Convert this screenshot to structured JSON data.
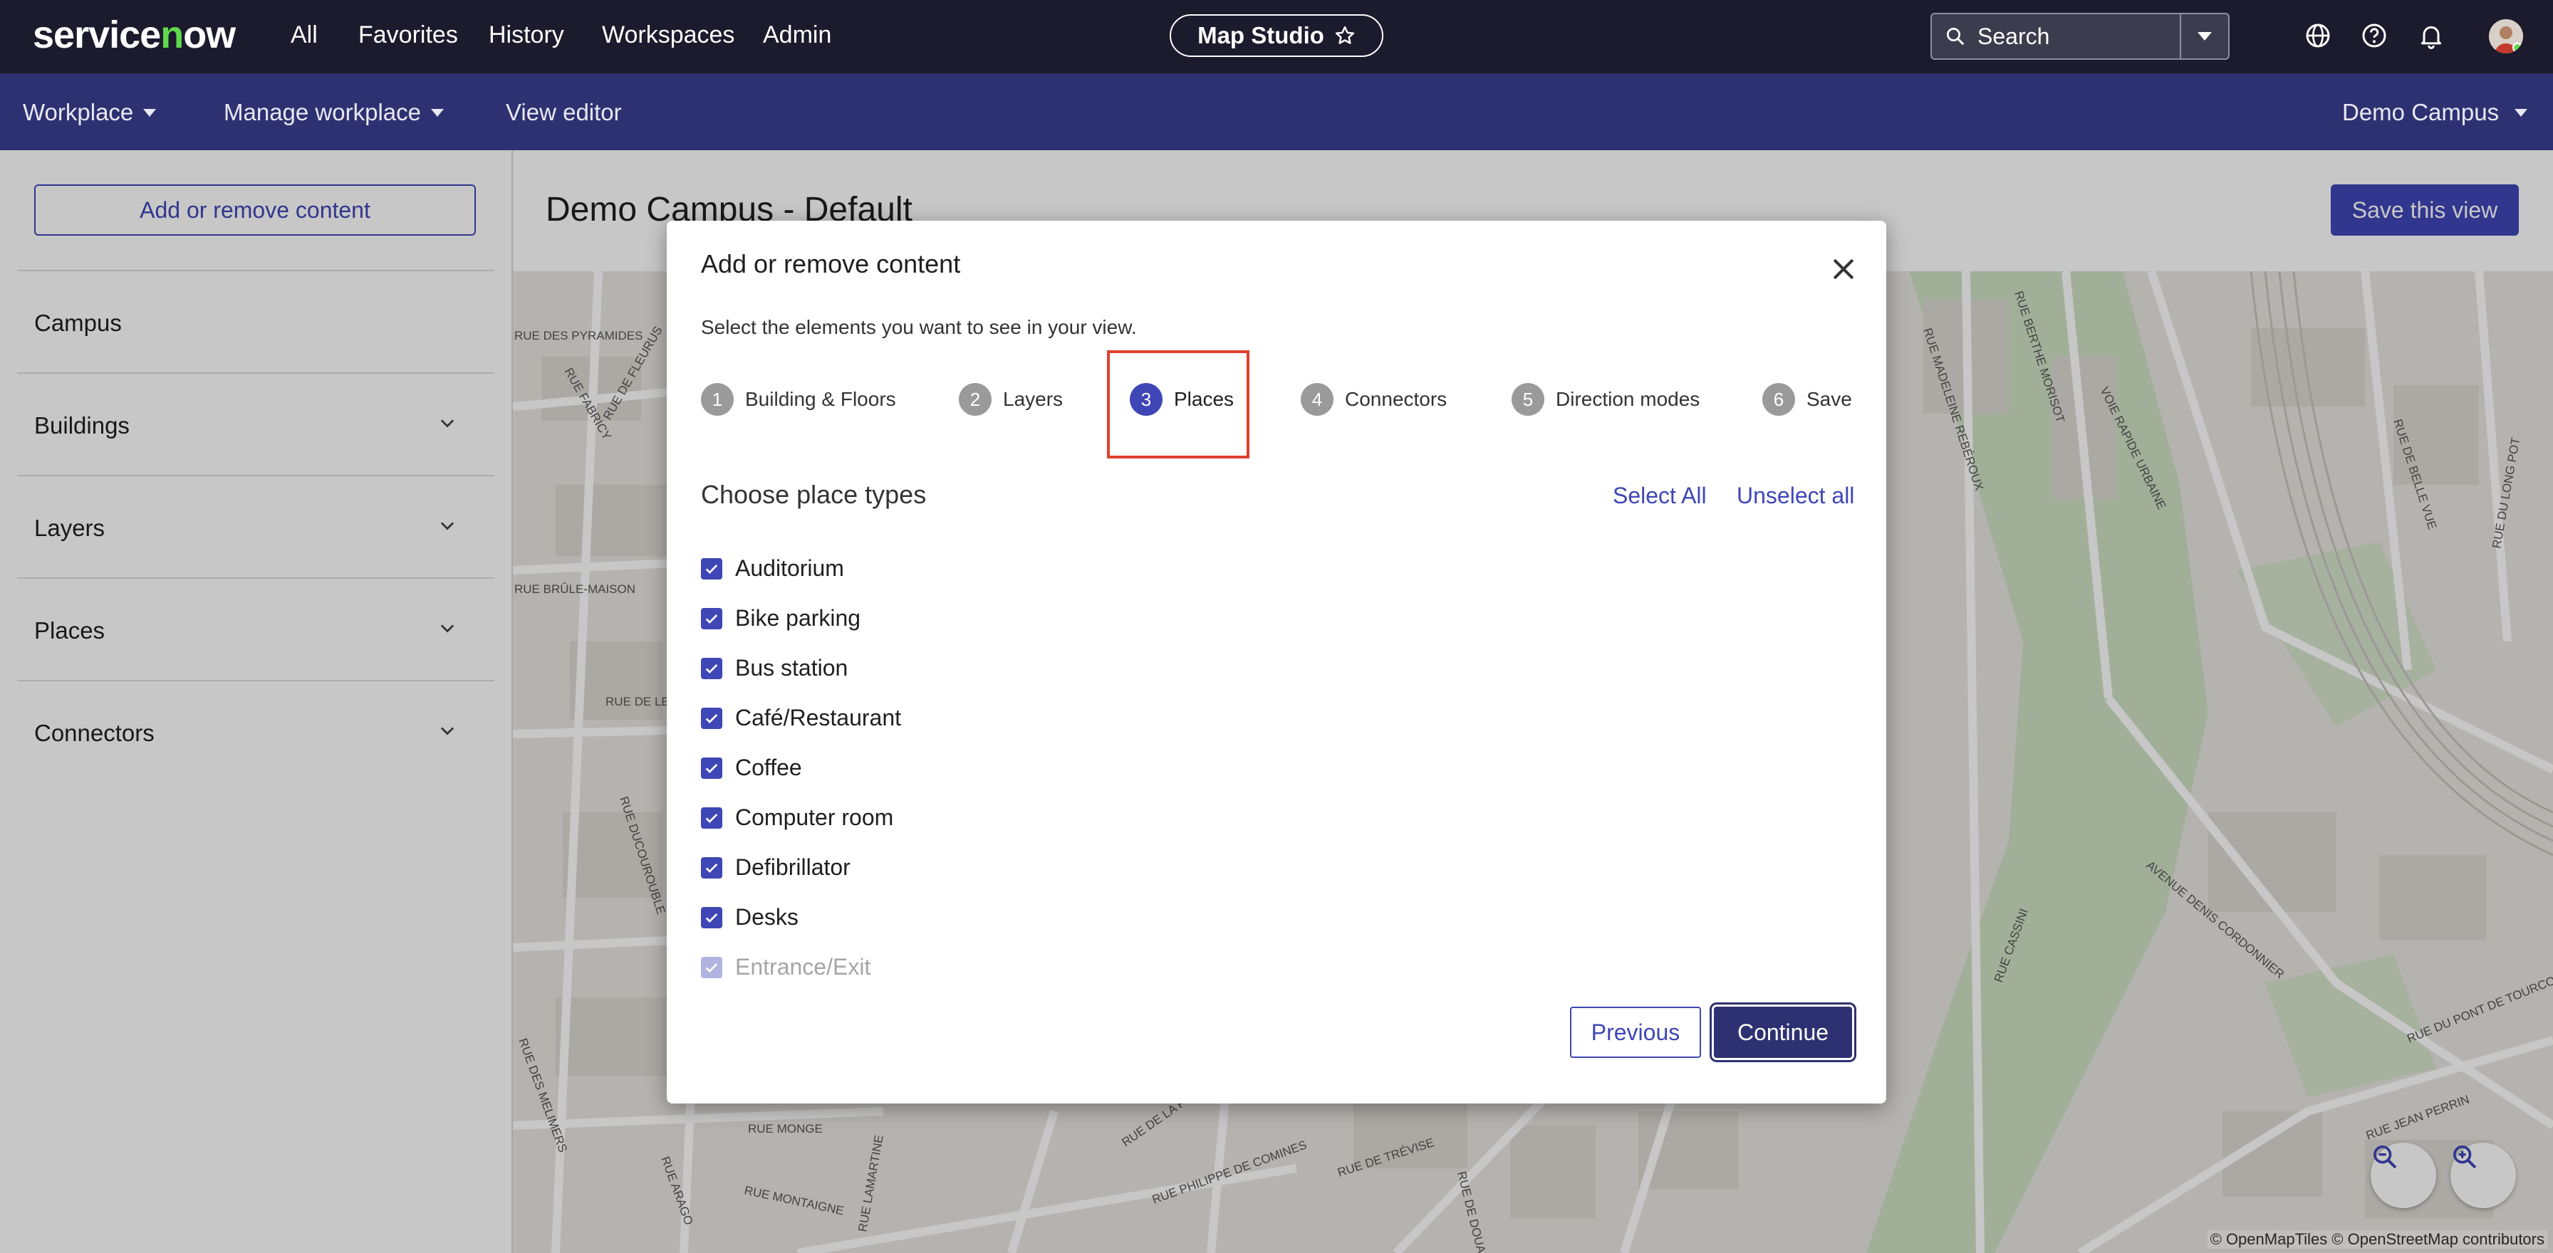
{
  "topnav": {
    "logo": "servicenow",
    "links": [
      "All",
      "Favorites",
      "History",
      "Workspaces",
      "Admin"
    ],
    "studio_pill": "Map Studio",
    "search_label": "Search",
    "icons": [
      "search-icon",
      "globe-icon",
      "help-icon",
      "bell-icon",
      "star-icon"
    ]
  },
  "subnav": {
    "workplace": "Workplace",
    "manage_workplace": "Manage workplace",
    "view_editor": "View editor",
    "campus_select": "Demo Campus"
  },
  "sidebar": {
    "add_remove_button": "Add or remove content",
    "items": [
      {
        "label": "Campus",
        "expandable": false
      },
      {
        "label": "Buildings",
        "expandable": true
      },
      {
        "label": "Layers",
        "expandable": true
      },
      {
        "label": "Places",
        "expandable": true
      },
      {
        "label": "Connectors",
        "expandable": true
      }
    ]
  },
  "main": {
    "title": "Demo Campus - Default",
    "save_button": "Save this view",
    "attribution": "© OpenMapTiles © OpenStreetMap contributors",
    "street_labels": [
      "RUE DES PYRAMIDES",
      "RUE FABRICY",
      "RUE DE FLEURUS",
      "RUE BRÛLE-MAISON",
      "RUE DE LENS",
      "RUE DUCOUROUBLE",
      "RUE DES MELIMERS",
      "RUE MONGE",
      "RUE ARAGO",
      "RUE MONTAIGNE",
      "RUE LAMARTINE",
      "RUE DE LA FONTAINE",
      "RUE PHILIPPE DE COMINES",
      "RUE DE TRÉVISE",
      "RUE DE DOUAI",
      "RUE MADELEINE REBÉROUX",
      "RUE BERTHE MORISOT",
      "VOIE RAPIDE URBAINE",
      "RUE DE BELLE VUE",
      "RUE DU LONG POT",
      "AVENUE DENIS CORDONNIER",
      "RUE DU PONT DE TOURCOING",
      "RUE JEAN PERRIN",
      "RUE CASSINI"
    ]
  },
  "dialog": {
    "title": "Add or remove content",
    "subtitle": "Select the elements you want to see in your view.",
    "steps": [
      {
        "num": "1",
        "label": "Building & Floors",
        "active": false
      },
      {
        "num": "2",
        "label": "Layers",
        "active": false
      },
      {
        "num": "3",
        "label": "Places",
        "active": true
      },
      {
        "num": "4",
        "label": "Connectors",
        "active": false
      },
      {
        "num": "5",
        "label": "Direction modes",
        "active": false
      },
      {
        "num": "6",
        "label": "Save",
        "active": false
      }
    ],
    "section_title": "Choose place types",
    "select_all": "Select All",
    "unselect_all": "Unselect all",
    "place_types": [
      {
        "label": "Auditorium",
        "checked": true
      },
      {
        "label": "Bike parking",
        "checked": true
      },
      {
        "label": "Bus station",
        "checked": true
      },
      {
        "label": "Café/Restaurant",
        "checked": true
      },
      {
        "label": "Coffee",
        "checked": true
      },
      {
        "label": "Computer room",
        "checked": true
      },
      {
        "label": "Defibrillator",
        "checked": true
      },
      {
        "label": "Desks",
        "checked": true
      },
      {
        "label": "Entrance/Exit",
        "checked": true
      }
    ],
    "previous_button": "Previous",
    "continue_button": "Continue"
  },
  "colors": {
    "topnav_bg": "#1b1b2d",
    "subnav_bg": "#2e3171",
    "accent": "#3f46b6",
    "highlight_box": "#e0402f",
    "logo_accent": "#62d84e"
  }
}
